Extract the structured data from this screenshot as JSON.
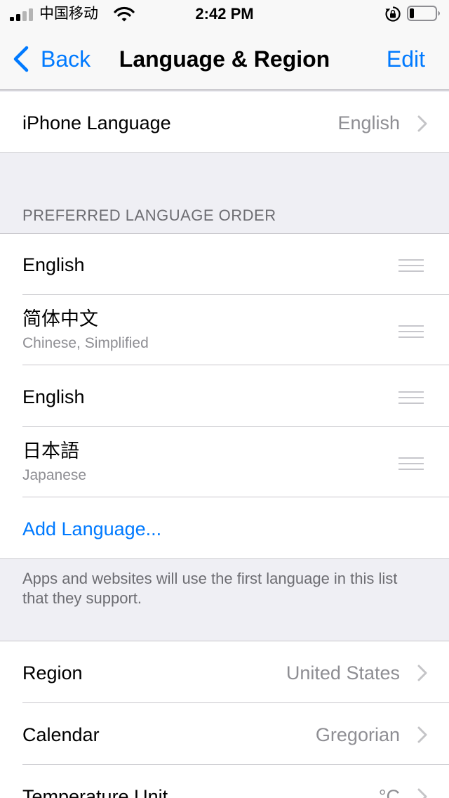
{
  "status_bar": {
    "carrier": "中国移动",
    "time": "2:42 PM"
  },
  "nav": {
    "back_label": "Back",
    "title": "Language & Region",
    "edit_label": "Edit",
    "accent_color": "#007aff"
  },
  "iphone_language": {
    "label": "iPhone Language",
    "value": "English"
  },
  "preferred_languages": {
    "header": "PREFERRED LANGUAGE ORDER",
    "items": [
      {
        "name": "English",
        "subtitle": ""
      },
      {
        "name": "简体中文",
        "subtitle": "Chinese, Simplified"
      },
      {
        "name": "English",
        "subtitle": ""
      },
      {
        "name": "日本語",
        "subtitle": "Japanese"
      }
    ],
    "add_label": "Add Language...",
    "footer": "Apps and websites will use the first language in this list that they support."
  },
  "settings": [
    {
      "label": "Region",
      "value": "United States"
    },
    {
      "label": "Calendar",
      "value": "Gregorian"
    },
    {
      "label": "Temperature Unit",
      "value": "°C"
    }
  ]
}
